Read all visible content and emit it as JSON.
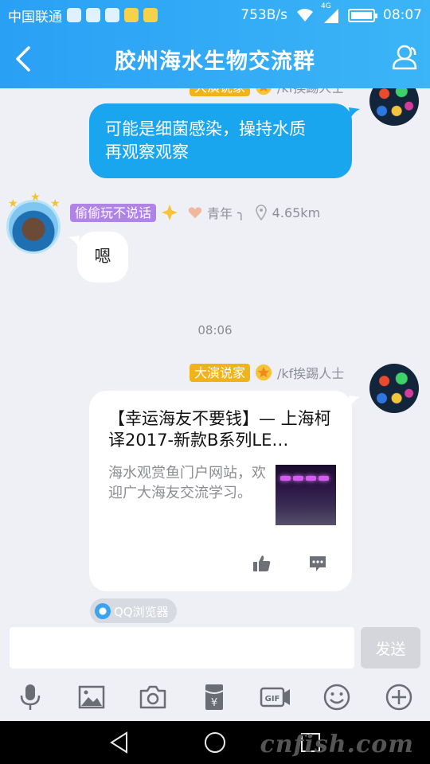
{
  "status_bar": {
    "carrier": "中国联通",
    "network_speed": "753B/s",
    "network_type": "4G",
    "time": "08:07"
  },
  "header": {
    "title": "胶州海水生物交流群"
  },
  "messages": {
    "first": {
      "sender_badge": "大演说家",
      "sender_name": "/kf挨踢人士",
      "text_line1": "可能是细菌感染，操持水质",
      "text_line2": "再观察观察"
    },
    "second": {
      "sender_badge": "偷偷玩不说话",
      "age_group": "青年",
      "suffix": "╮",
      "distance": "4.65km",
      "text": "嗯"
    },
    "timestamp": "08:06",
    "third": {
      "sender_badge": "大演说家",
      "sender_name": "/kf挨踢人士",
      "card_title": "【幸运海友不要钱】— 上海柯译2017-新款B系列LE…",
      "card_desc": "海水观赏鱼门户网站，欢迎广大海友交流学习。",
      "source": "QQ浏览器"
    }
  },
  "input": {
    "value": "",
    "placeholder": "",
    "send_label": "发送"
  },
  "watermark": "cnfish.com",
  "colors": {
    "accent": "#1aa5ef",
    "header": "#2aa0f5",
    "badge_gold": "#f0b31a",
    "badge_purple": "#b084e6"
  }
}
